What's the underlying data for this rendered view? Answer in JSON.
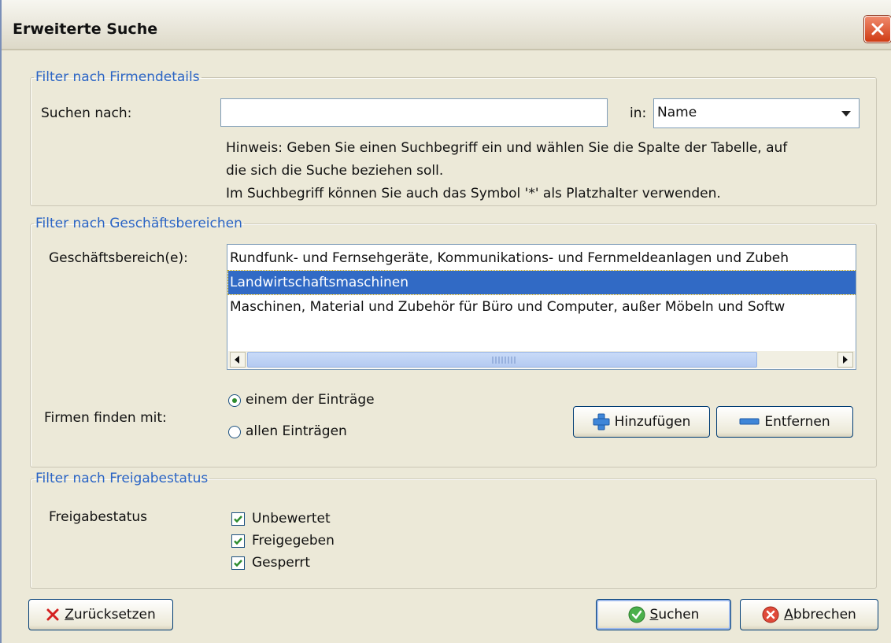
{
  "window": {
    "title": "Erweiterte Suche"
  },
  "firmendetails": {
    "legend": "Filter nach Firmendetails",
    "search_label": "Suchen nach:",
    "search_value": "",
    "in_label": "in:",
    "column_select": "Name",
    "hint_lines": [
      "Hinweis: Geben Sie einen Suchbegriff ein und wählen Sie die Spalte der Tabelle, auf",
      "die sich die Suche beziehen soll.",
      "Im Suchbegriff können Sie auch das Symbol '*' als Platzhalter verwenden."
    ]
  },
  "geschaeftsbereiche": {
    "legend": "Filter nach Geschäftsbereichen",
    "list_label": "Geschäftsbereich(e):",
    "items": [
      {
        "label": "Rundfunk- und Fernsehgeräte, Kommunikations- und Fernmeldeanlagen und Zubeh",
        "selected": false
      },
      {
        "label": "Landwirtschaftsmaschinen",
        "selected": true
      },
      {
        "label": "Maschinen, Material und Zubehör für Büro und Computer, außer Möbeln und Softw",
        "selected": false
      }
    ],
    "match_label": "Firmen finden mit:",
    "match_options": [
      {
        "label": "einem der Einträge",
        "checked": true
      },
      {
        "label": "allen Einträgen",
        "checked": false
      }
    ],
    "add_button": "Hinzufügen",
    "remove_button": "Entfernen"
  },
  "freigabestatus": {
    "legend": "Filter nach Freigabestatus",
    "label": "Freigabestatus",
    "options": [
      {
        "label": "Unbewertet",
        "checked": true
      },
      {
        "label": "Freigegeben",
        "checked": true
      },
      {
        "label": "Gesperrt",
        "checked": true
      }
    ]
  },
  "footer": {
    "reset_mnemonic": "Z",
    "reset_rest": "urücksetzen",
    "search_mnemonic": "S",
    "search_rest": "uchen",
    "cancel_mnemonic": "A",
    "cancel_rest": "bbrechen"
  },
  "colors": {
    "legend": "#2a64c5",
    "selection": "#316ac5",
    "check": "#2e8c2e"
  }
}
